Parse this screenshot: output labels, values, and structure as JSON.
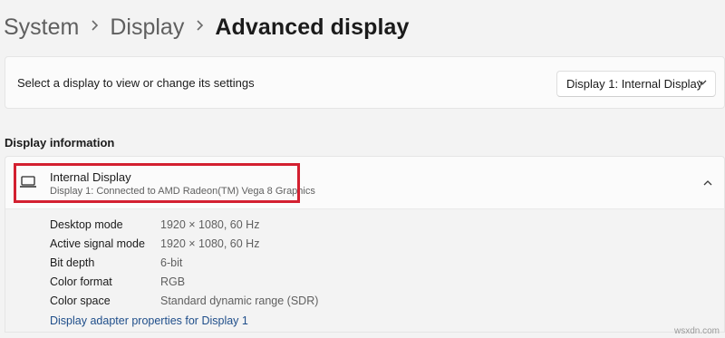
{
  "breadcrumb": {
    "items": [
      "System",
      "Display"
    ],
    "current": "Advanced display",
    "separator": "›"
  },
  "display_select": {
    "label": "Select a display to view or change its settings",
    "selected": "Display 1: Internal Display"
  },
  "section": {
    "title": "Display information"
  },
  "display_info": {
    "name": "Internal Display",
    "subtitle": "Display 1: Connected to AMD Radeon(TM) Vega 8 Graphics",
    "rows": [
      {
        "label": "Desktop mode",
        "value": "1920 × 1080, 60 Hz"
      },
      {
        "label": "Active signal mode",
        "value": "1920 × 1080, 60 Hz"
      },
      {
        "label": "Bit depth",
        "value": "6-bit"
      },
      {
        "label": "Color format",
        "value": "RGB"
      },
      {
        "label": "Color space",
        "value": "Standard dynamic range (SDR)"
      }
    ],
    "link": "Display adapter properties for Display 1"
  },
  "watermark": "wsxdn.com",
  "colors": {
    "highlight": "#d32030",
    "link": "#1f4e8a",
    "background": "#f3f3f3"
  },
  "icons": [
    "chevron-right-icon",
    "chevron-down-icon",
    "laptop-icon",
    "chevron-up-icon"
  ]
}
